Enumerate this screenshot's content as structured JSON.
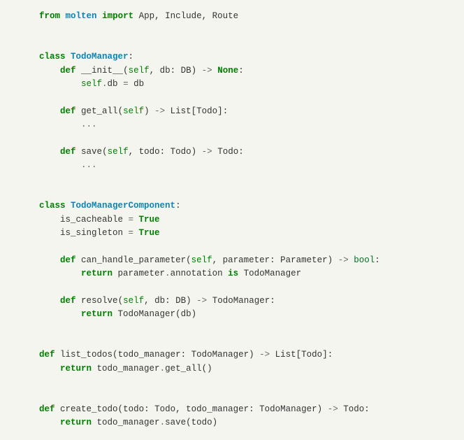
{
  "code": {
    "import_line": {
      "from_kw": "from",
      "module": "molten",
      "import_kw": "import",
      "names": "App, Include, Route"
    },
    "classes": [
      {
        "class_kw": "class",
        "name": "TodoManager",
        "colon": ":",
        "methods": [
          {
            "def_kw": "def",
            "name": "__init__",
            "open": "(",
            "self_kw": "self",
            "comma1": ", ",
            "param1_name": "db",
            "param1_colon": ": ",
            "param1_type": "DB",
            "close": ")",
            "arrow": " -> ",
            "ret": "None",
            "end": ":",
            "body": {
              "self_kw": "self",
              "dot": ".",
              "attr": "db",
              "eq": " = ",
              "rhs": "db"
            }
          },
          {
            "def_kw": "def",
            "name": "get_all",
            "open": "(",
            "self_kw": "self",
            "close": ")",
            "arrow": " -> ",
            "ret_outer": "List",
            "ret_open": "[",
            "ret_inner": "Todo",
            "ret_close": "]",
            "end": ":",
            "body_text": "..."
          },
          {
            "def_kw": "def",
            "name": "save",
            "open": "(",
            "self_kw": "self",
            "comma1": ", ",
            "param1_name": "todo",
            "param1_colon": ": ",
            "param1_type": "Todo",
            "close": ")",
            "arrow": " -> ",
            "ret": "Todo",
            "end": ":",
            "body_text": "..."
          }
        ]
      },
      {
        "class_kw": "class",
        "name": "TodoManagerComponent",
        "colon": ":",
        "attrs": [
          {
            "name": "is_cacheable",
            "eq": " = ",
            "val": "True"
          },
          {
            "name": "is_singleton",
            "eq": " = ",
            "val": "True"
          }
        ],
        "methods": [
          {
            "def_kw": "def",
            "name": "can_handle_parameter",
            "open": "(",
            "self_kw": "self",
            "comma1": ", ",
            "param1_name": "parameter",
            "param1_colon": ": ",
            "param1_type": "Parameter",
            "close": ")",
            "arrow": " -> ",
            "ret": "bool",
            "end": ":",
            "body": {
              "return_kw": "return",
              "sp": " ",
              "obj": "parameter",
              "dot": ".",
              "attr": "annotation",
              "is_kw": " is ",
              "rhs": "TodoManager"
            }
          },
          {
            "def_kw": "def",
            "name": "resolve",
            "open": "(",
            "self_kw": "self",
            "comma1": ", ",
            "param1_name": "db",
            "param1_colon": ": ",
            "param1_type": "DB",
            "close": ")",
            "arrow": " -> ",
            "ret": "TodoManager",
            "end": ":",
            "body": {
              "return_kw": "return",
              "sp": " ",
              "call": "TodoManager",
              "open": "(",
              "arg": "db",
              "close": ")"
            }
          }
        ]
      }
    ],
    "funcs": [
      {
        "def_kw": "def",
        "name": "list_todos",
        "open": "(",
        "param1_name": "todo_manager",
        "param1_colon": ": ",
        "param1_type": "TodoManager",
        "close": ")",
        "arrow": " -> ",
        "ret_outer": "List",
        "ret_open": "[",
        "ret_inner": "Todo",
        "ret_close": "]",
        "end": ":",
        "body": {
          "return_kw": "return",
          "sp": " ",
          "obj": "todo_manager",
          "dot": ".",
          "call": "get_all",
          "parens": "()"
        }
      },
      {
        "def_kw": "def",
        "name": "create_todo",
        "open": "(",
        "param1_name": "todo",
        "param1_colon": ": ",
        "param1_type": "Todo",
        "comma1": ", ",
        "param2_name": "todo_manager",
        "param2_colon": ": ",
        "param2_type": "TodoManager",
        "close": ")",
        "arrow": " -> ",
        "ret": "Todo",
        "end": ":",
        "body": {
          "return_kw": "return",
          "sp": " ",
          "obj": "todo_manager",
          "dot": ".",
          "call": "save",
          "open": "(",
          "arg": "todo",
          "close": ")"
        }
      }
    ]
  }
}
